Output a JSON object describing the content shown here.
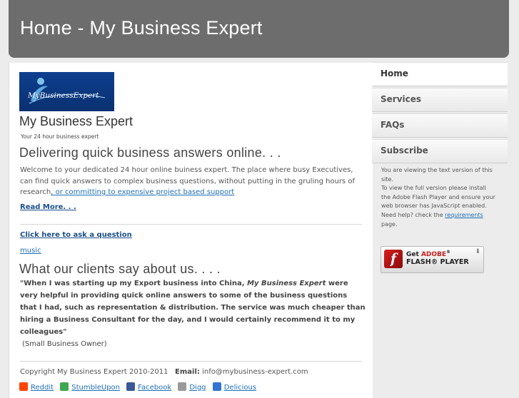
{
  "header": {
    "title": "Home - My Business Expert"
  },
  "logo": {
    "text": "MyBusinessExpert"
  },
  "site": {
    "title": "My Business Expert",
    "tagline": "Your 24 hour business expert"
  },
  "intro": {
    "heading": "Delivering quick business answers online. . .",
    "body": "Welcome to your dedicated 24 hour online buiness expert. The place where busy Executives, can find quick answers to complex business questions, without putting in the gruling hours of research",
    "link_text": ", or committing to expensive project based support",
    "read_more": "Read More. . ."
  },
  "ask_link": "Click here to ask a question",
  "music_link": "music",
  "testimonials": {
    "heading": "What our clients say about us. . . .",
    "quote_start": "\"When I was starting up my Export business into China, ",
    "quote_em": "My Business Expert",
    "quote_end": " were very helpful in providing quick online answers to some of the business questions that I had, such as representation & distribution. The service was much cheaper than hiring a Business Consultant for the day, and I would certainly recommend it to my colleagues\"",
    "author": "(Small Business Owner)"
  },
  "footer": {
    "copyright": "Copyright My Business Expert 2010-2011",
    "email_label": "Email:",
    "email": "info@mybusiness-expert.com"
  },
  "social": [
    {
      "label": "Reddit",
      "icon": "reddit-icon",
      "color": "#ff4500"
    },
    {
      "label": "StumbleUpon",
      "icon": "stumbleupon-icon",
      "color": "#3fa652"
    },
    {
      "label": "Facebook",
      "icon": "facebook-icon",
      "color": "#3b5998"
    },
    {
      "label": "Digg",
      "icon": "digg-icon",
      "color": "#999999"
    },
    {
      "label": "Delicious",
      "icon": "delicious-icon",
      "color": "#3274d1"
    }
  ],
  "nav": [
    "Home",
    "Services",
    "FAQs",
    "Subscribe"
  ],
  "flash_note": {
    "line1": "You are viewing the text version of this site.",
    "line2": "To view the full version please install the Adobe Flash Player and ensure your web browser has JavaScript enabled.",
    "help_prefix": "Need help? check the ",
    "help_link": "requirements",
    "help_suffix": " page."
  },
  "flash_badge": {
    "get": "Get",
    "adobe": "ADOBE",
    "registered": "®",
    "player": "FLASH® PLAYER",
    "icon_letter": "f"
  },
  "colors": {
    "header_bg": "#6d6d6d",
    "link": "#1e6fb6",
    "logo_bg": "#0e3f8f"
  }
}
